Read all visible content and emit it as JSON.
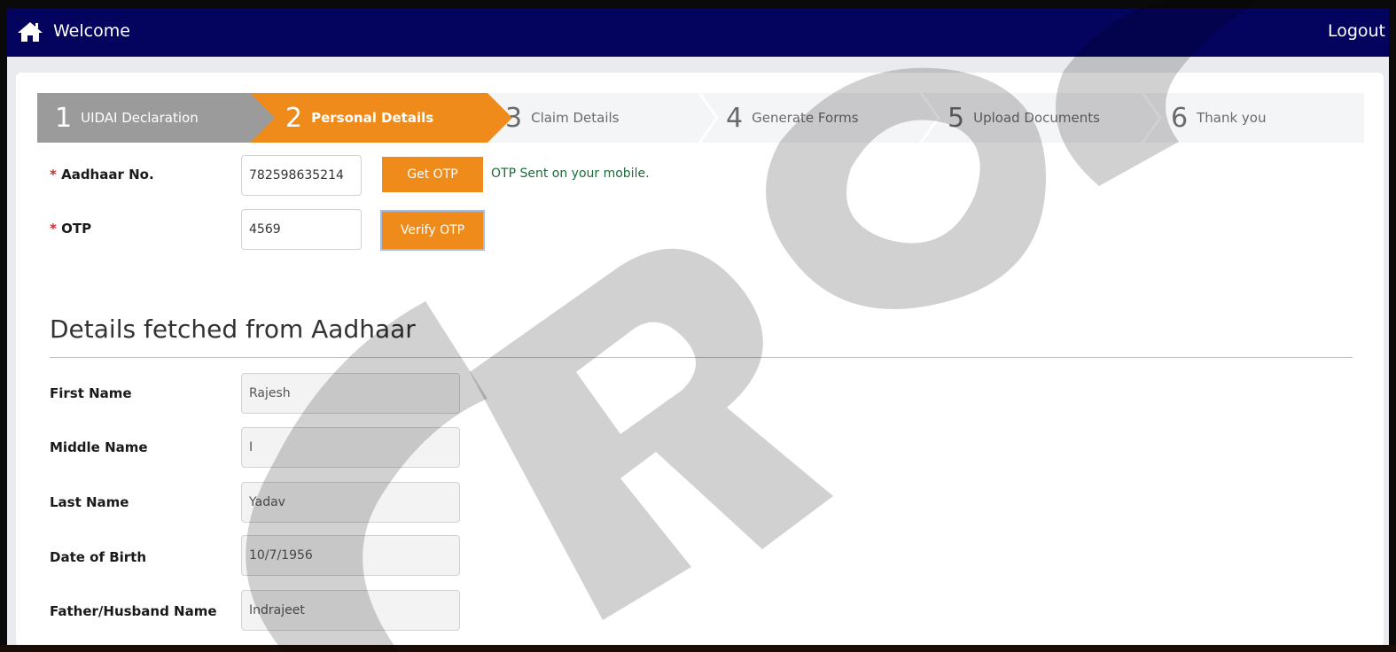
{
  "header": {
    "title": "Welcome",
    "logout_label": "Logout"
  },
  "wizard": {
    "steps": [
      {
        "num": "1",
        "label": "UIDAI Declaration"
      },
      {
        "num": "2",
        "label": "Personal Details"
      },
      {
        "num": "3",
        "label": "Claim Details"
      },
      {
        "num": "4",
        "label": "Generate Forms"
      },
      {
        "num": "5",
        "label": "Upload Documents"
      },
      {
        "num": "6",
        "label": "Thank you"
      }
    ],
    "active_step": "2"
  },
  "verification": {
    "aadhaar_label": "Aadhaar No.",
    "aadhaar_value": "782598635214",
    "get_otp_label": "Get OTP",
    "otp_message": "OTP Sent on your mobile.",
    "otp_label": "OTP",
    "otp_value": "4569",
    "verify_otp_label": "Verify OTP",
    "required_mark": "*"
  },
  "details": {
    "section_title": "Details fetched from Aadhaar",
    "fields": [
      {
        "label": "First Name",
        "value": "Rajesh"
      },
      {
        "label": "Middle Name",
        "value": "I"
      },
      {
        "label": "Last Name",
        "value": "Yadav"
      },
      {
        "label": "Date of Birth",
        "value": "10/7/1956"
      },
      {
        "label": "Father/Husband Name",
        "value": "Indrajeet"
      }
    ]
  },
  "colors": {
    "topbar": "#04035e",
    "accent": "#ef8b1a",
    "completed_step": "#9b9b9b",
    "success_text": "#1b6b3a",
    "required": "#d9262b"
  },
  "watermark": {
    "icon": "crop-watermark"
  }
}
